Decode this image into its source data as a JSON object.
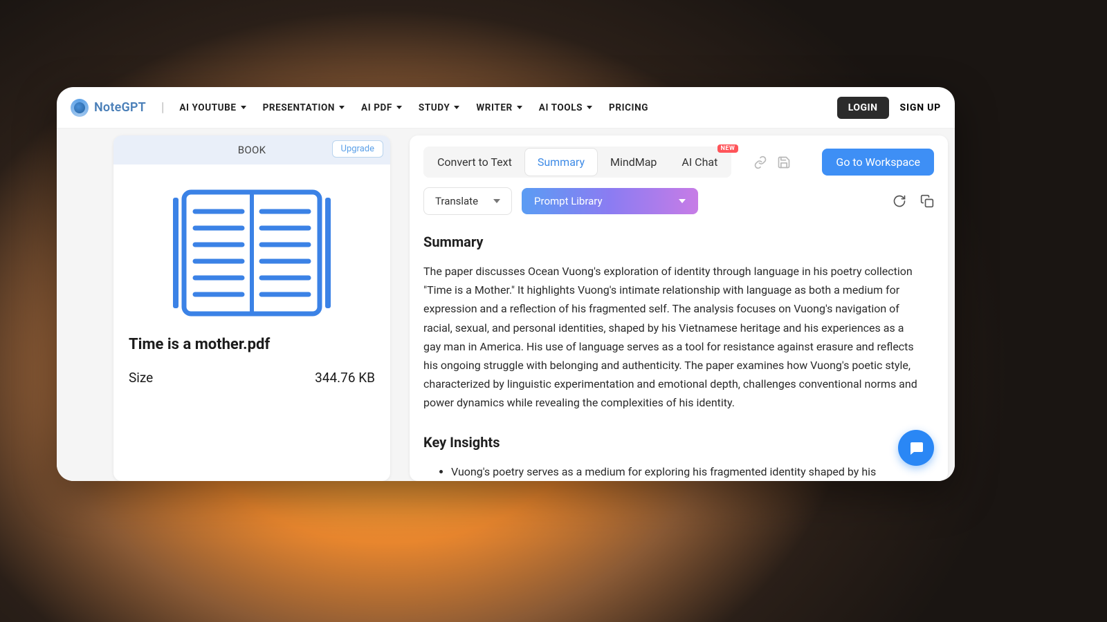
{
  "brand": {
    "name": "NoteGPT"
  },
  "nav": {
    "items": [
      {
        "label": "AI YOUTUBE",
        "dropdown": true
      },
      {
        "label": "PRESENTATION",
        "dropdown": true
      },
      {
        "label": "AI PDF",
        "dropdown": true
      },
      {
        "label": "STUDY",
        "dropdown": true
      },
      {
        "label": "WRITER",
        "dropdown": true
      },
      {
        "label": "AI TOOLS",
        "dropdown": true
      },
      {
        "label": "PRICING",
        "dropdown": false
      }
    ],
    "login": "LOGIN",
    "signup": "SIGN UP"
  },
  "leftPanel": {
    "header": "BOOK",
    "upgrade": "Upgrade",
    "fileName": "Time is a mother.pdf",
    "sizeLabel": "Size",
    "sizeValue": "344.76 KB"
  },
  "tabs": {
    "items": [
      {
        "label": "Convert to Text",
        "active": false,
        "badge": null
      },
      {
        "label": "Summary",
        "active": true,
        "badge": null
      },
      {
        "label": "MindMap",
        "active": false,
        "badge": null
      },
      {
        "label": "AI Chat",
        "active": false,
        "badge": "NEW"
      }
    ],
    "workspace": "Go to Workspace"
  },
  "controls": {
    "translate": "Translate",
    "promptLibrary": "Prompt Library"
  },
  "summary": {
    "heading": "Summary",
    "body": "The paper discusses Ocean Vuong's exploration of identity through language in his poetry collection \"Time is a Mother.\" It highlights Vuong's intimate relationship with language as both a medium for expression and a reflection of his fragmented self. The analysis focuses on Vuong's navigation of racial, sexual, and personal identities, shaped by his Vietnamese heritage and his experiences as a gay man in America. His use of language serves as a tool for resistance against erasure and reflects his ongoing struggle with belonging and authenticity. The paper examines how Vuong's poetic style, characterized by linguistic experimentation and emotional depth, challenges conventional norms and power dynamics while revealing the complexities of his identity.",
    "insightsHeading": "Key Insights",
    "insights": [
      "Vuong's poetry serves as a medium for exploring his fragmented identity shaped by his Vietnamese-American background and sexuality."
    ]
  }
}
